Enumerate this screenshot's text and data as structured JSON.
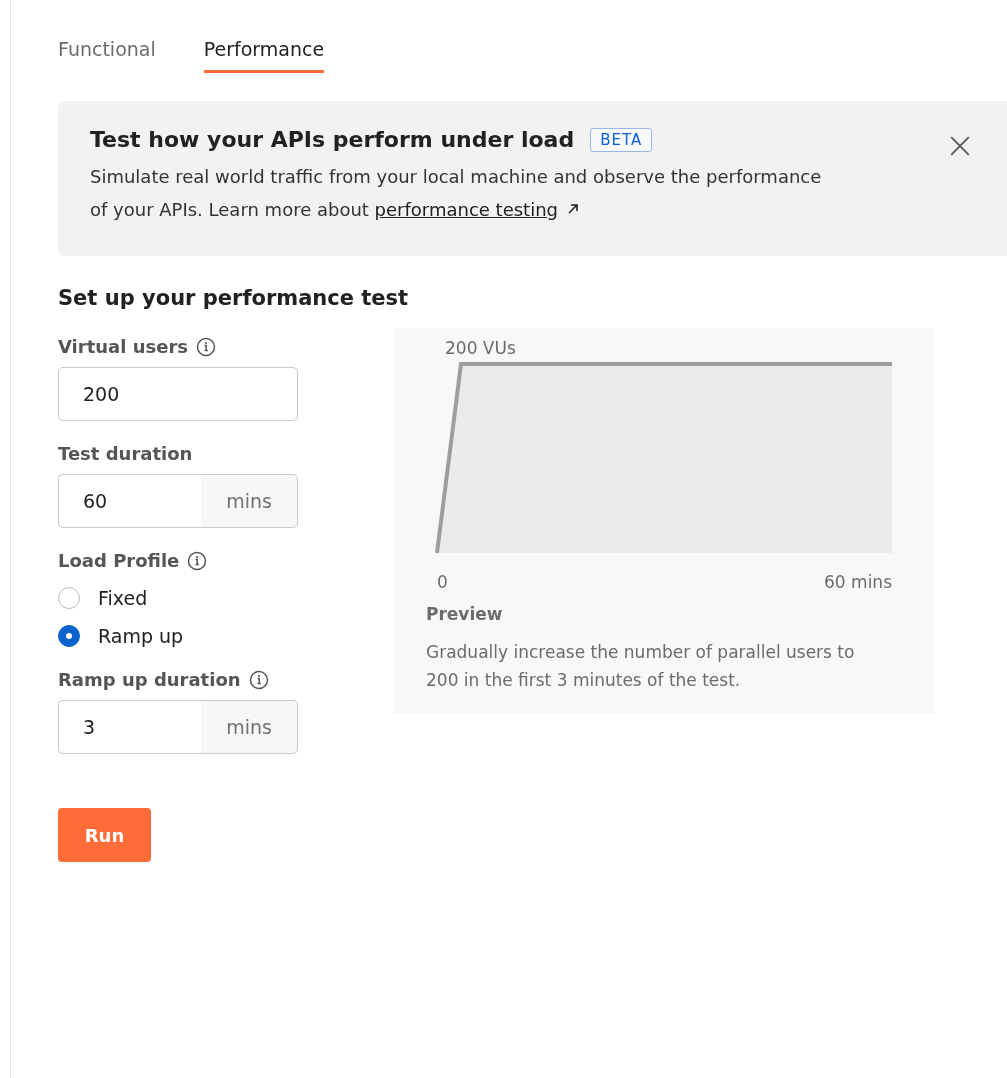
{
  "tabs": [
    {
      "label": "Functional",
      "selected": false
    },
    {
      "label": "Performance",
      "selected": true
    }
  ],
  "banner": {
    "title": "Test how your APIs perform under load",
    "badge": "BETA",
    "text": "Simulate real world traffic from your local machine and observe the performance of your APIs. Learn more about ",
    "link": "performance testing"
  },
  "heading": "Set up your performance test",
  "form": [
    {
      "kind": "number",
      "label": "Virtual users",
      "info": true,
      "value": "200"
    },
    {
      "kind": "number",
      "label": "Test duration",
      "info": false,
      "value": "60",
      "unit": "mins"
    },
    {
      "kind": "radio_group",
      "label": "Load Profile",
      "info": true,
      "options": [
        {
          "label": "Fixed",
          "selected": false
        },
        {
          "label": "Ramp up",
          "selected": true
        }
      ]
    },
    {
      "kind": "number",
      "label": "Ramp up duration",
      "info": true,
      "value": "3",
      "unit": "mins"
    }
  ],
  "run_button": "Run",
  "preview": {
    "peak_label": "200 VUs",
    "start_label": "0",
    "end_label": "60 mins",
    "title": "Preview",
    "description": "Gradually increase the number of parallel users to 200 in the first 3 minutes of the test."
  }
}
